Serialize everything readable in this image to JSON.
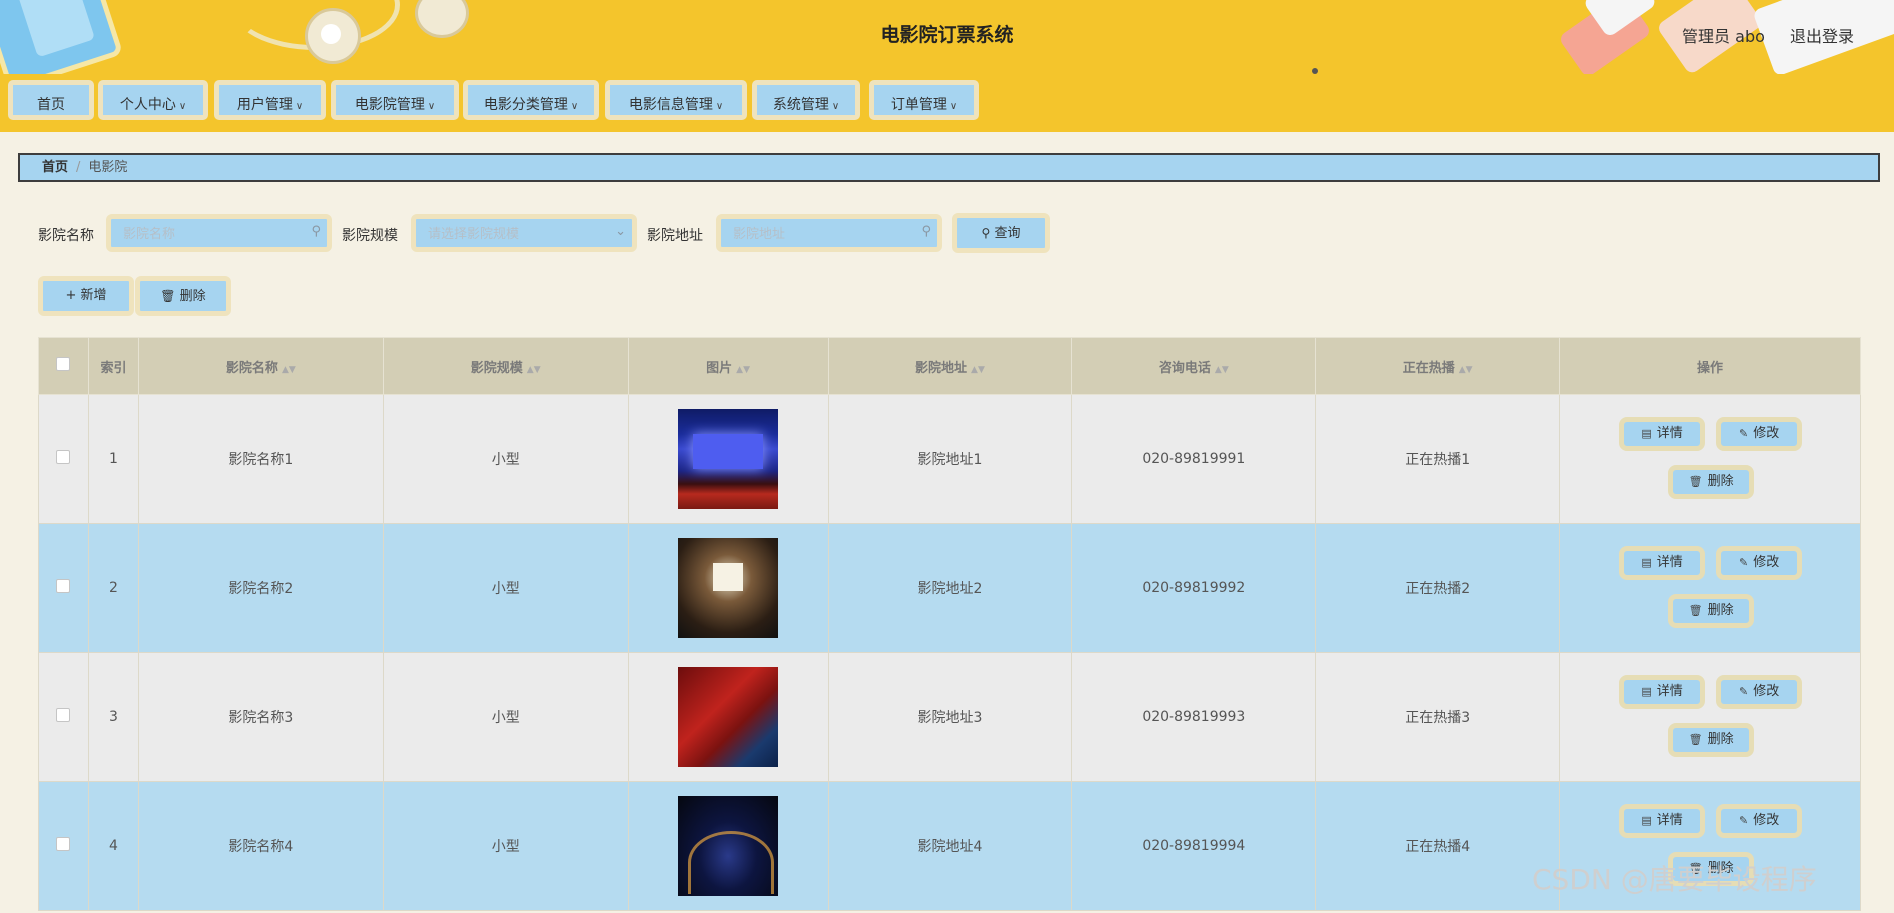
{
  "header": {
    "title": "电影院订票系统",
    "user": "管理员 abo",
    "logout": "退出登录"
  },
  "nav": [
    {
      "label": "首页",
      "dropdown": false
    },
    {
      "label": "个人中心",
      "dropdown": true
    },
    {
      "label": "用户管理",
      "dropdown": true
    },
    {
      "label": "电影院管理",
      "dropdown": true
    },
    {
      "label": "电影分类管理",
      "dropdown": true
    },
    {
      "label": "电影信息管理",
      "dropdown": true
    },
    {
      "label": "系统管理",
      "dropdown": true
    },
    {
      "label": "订单管理",
      "dropdown": true
    }
  ],
  "breadcrumb": {
    "home": "首页",
    "separator": "/",
    "current": "电影院"
  },
  "search": {
    "name_label": "影院名称",
    "name_placeholder": "影院名称",
    "scale_label": "影院规模",
    "scale_placeholder": "请选择影院规模",
    "address_label": "影院地址",
    "address_placeholder": "影院地址",
    "query_button": "查询"
  },
  "actions": {
    "add": "新增",
    "delete": "删除"
  },
  "table": {
    "columns": {
      "index": "索引",
      "name": "影院名称",
      "scale": "影院规模",
      "image": "图片",
      "address": "影院地址",
      "phone": "咨询电话",
      "showing": "正在热播",
      "ops": "操作"
    },
    "buttons": {
      "detail": "详情",
      "edit": "修改",
      "delete": "删除"
    },
    "rows": [
      {
        "index": "1",
        "name": "影院名称1",
        "scale": "小型",
        "address": "影院地址1",
        "phone": "020-89819991",
        "showing": "正在热播1"
      },
      {
        "index": "2",
        "name": "影院名称2",
        "scale": "小型",
        "address": "影院地址2",
        "phone": "020-89819992",
        "showing": "正在热播2"
      },
      {
        "index": "3",
        "name": "影院名称3",
        "scale": "小型",
        "address": "影院地址3",
        "phone": "020-89819993",
        "showing": "正在热播3"
      },
      {
        "index": "4",
        "name": "影院名称4",
        "scale": "小型",
        "address": "影院地址4",
        "phone": "020-89819994",
        "showing": "正在热播4"
      }
    ]
  },
  "watermark": "CSDN @唐要毕设程序",
  "colors": {
    "header_bg": "#f4c52c",
    "button_bg": "#a6d4f0",
    "page_bg": "#f5f1e4",
    "row_alt": "#b5dbf0"
  }
}
